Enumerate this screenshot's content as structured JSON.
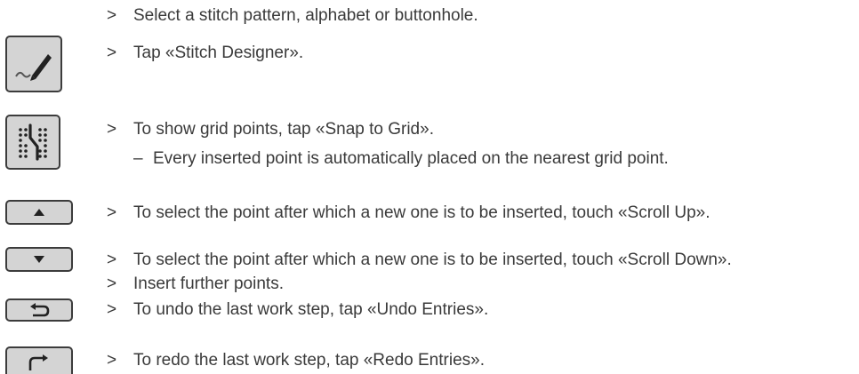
{
  "steps": [
    {
      "marker": ">",
      "text": "Select a stitch pattern, alphabet or buttonhole."
    },
    {
      "marker": ">",
      "text": "Tap «Stitch Designer»."
    },
    {
      "marker": ">",
      "text": "To show grid points, tap «Snap to Grid»."
    },
    {
      "marker": "–",
      "text": "Every inserted point is automatically placed on the nearest grid point."
    },
    {
      "marker": ">",
      "text": "To select the point after which a new one is to be inserted, touch «Scroll Up»."
    },
    {
      "marker": ">",
      "text": "To select the point after which a new one is to be inserted, touch «Scroll Down»."
    },
    {
      "marker": ">",
      "text": "Insert further points."
    },
    {
      "marker": ">",
      "text": "To undo the last work step, tap «Undo Entries»."
    },
    {
      "marker": ">",
      "text": "To redo the last work step, tap «Redo Entries»."
    }
  ],
  "icons": {
    "stitch_designer": "pen-stitch-icon",
    "snap_to_grid": "snap-grid-icon",
    "scroll_up": "arrow-up-icon",
    "scroll_down": "arrow-down-icon",
    "undo": "undo-icon",
    "redo": "redo-icon"
  },
  "colors": {
    "text": "#3a3a3a",
    "button_fill": "#d4d4d4",
    "button_border": "#3c3c3c"
  }
}
